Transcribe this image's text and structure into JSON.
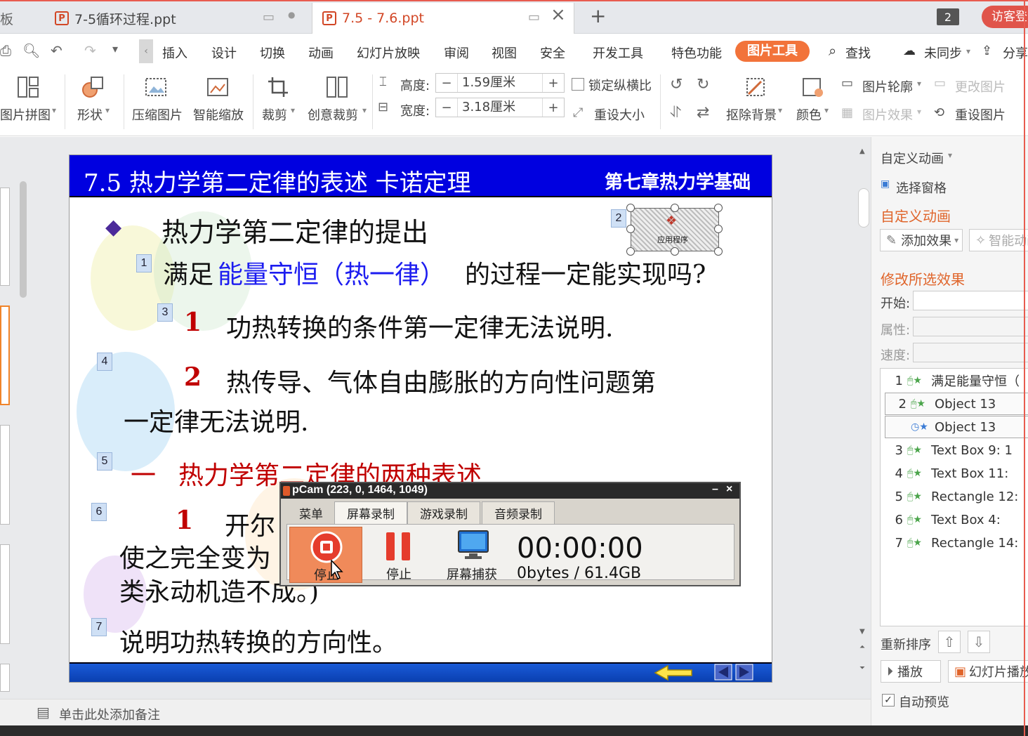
{
  "tabs": [
    {
      "label": "7-5循环过程.ppt",
      "active": false
    },
    {
      "label": "7.5 - 7.6.ppt",
      "active": true
    }
  ],
  "tabbar": {
    "new_tab": "+",
    "count": "2",
    "guest": "访客登"
  },
  "menu": {
    "items": [
      "插入",
      "设计",
      "切换",
      "动画",
      "幻灯片放映",
      "审阅",
      "视图",
      "安全",
      "开发工具",
      "特色功能"
    ],
    "picture_tools": "图片工具",
    "search": "查找",
    "sync": "未同步",
    "share": "分享"
  },
  "ribbon": {
    "picture_collage": "图片拼图",
    "shape": "形状",
    "compress": "压缩图片",
    "smart_zoom": "智能缩放",
    "crop": "裁剪",
    "creative_crop": "创意裁剪",
    "height_label": "高度:",
    "height_value": "1.59厘米",
    "width_label": "宽度:",
    "width_value": "3.18厘米",
    "lock_ratio": "锁定纵横比",
    "reset_size": "重设大小",
    "remove_bg": "抠除背景",
    "color": "颜色",
    "outline": "图片轮廓",
    "change_pic": "更改图片",
    "pic_effect": "图片效果",
    "reset_pic": "重设图片",
    "minus": "−",
    "plus": "+"
  },
  "slide": {
    "title": "7.5  热力学第二定律的表述  卡诺定理",
    "chapter": "第七章热力学基础",
    "lines": {
      "l1": "热力学第二定律的提出",
      "l2a": "满足",
      "l2b": "能量守恒（热一律）",
      "l2c": "的过程一定能实现吗?",
      "l3num": "1",
      "l3": "功热转换的条件第一定律无法说明.",
      "l4num": "2",
      "l4": "热传导、气体自由膨胀的方向性问题第",
      "l5": "一定律无法说明.",
      "l6num": "一",
      "l6": "热力学第二定律的两种表述",
      "l7num": "1",
      "l7": "开尔",
      "l8": "使之完全变为",
      "l9": "类永动机造不成。)",
      "l10": "说明功热转换的方向性。"
    },
    "anim_tags": [
      "1",
      "2",
      "3",
      "4",
      "5",
      "6",
      "7"
    ],
    "object_label": "应用程序"
  },
  "notes": {
    "placeholder": "单击此处添加备注"
  },
  "right_panel": {
    "custom_anim_menu": "自定义动画",
    "select_pane": "选择窗格",
    "heading": "自定义动画",
    "add_effect": "添加效果",
    "smart_anim": "智能动画",
    "modify_heading": "修改所选效果",
    "start_label": "开始:",
    "property_label": "属性:",
    "speed_label": "速度:",
    "list": [
      {
        "num": "1",
        "name": "满足能量守恒（"
      },
      {
        "num": "2",
        "name": "Object 13"
      },
      {
        "num": "",
        "name": "Object 13"
      },
      {
        "num": "3",
        "name": "Text Box 9: 1"
      },
      {
        "num": "4",
        "name": "Text Box 11:"
      },
      {
        "num": "5",
        "name": "Rectangle 12:"
      },
      {
        "num": "6",
        "name": "Text Box 4:"
      },
      {
        "num": "7",
        "name": "Rectangle 14:"
      }
    ],
    "reorder": "重新排序",
    "play": "播放",
    "slideshow": "幻灯片播放",
    "auto_preview": "自动预览"
  },
  "ocam": {
    "title": "pCam (223, 0, 1464, 1049)",
    "tabs": [
      "菜单",
      "屏幕录制",
      "游戏录制",
      "音频录制"
    ],
    "stop_record": "停止",
    "stop": "停止",
    "screen_capture": "屏幕捕获",
    "time": "00:00:00",
    "size": "0bytes / 61.4GB",
    "min": "–",
    "close": "×"
  },
  "colors": {
    "accent": "#f2733a",
    "slide_header": "#0000e0",
    "emphasis_red": "#c00000",
    "emphasis_blue": "#1d1df0",
    "panel_orange": "#e0652b"
  }
}
